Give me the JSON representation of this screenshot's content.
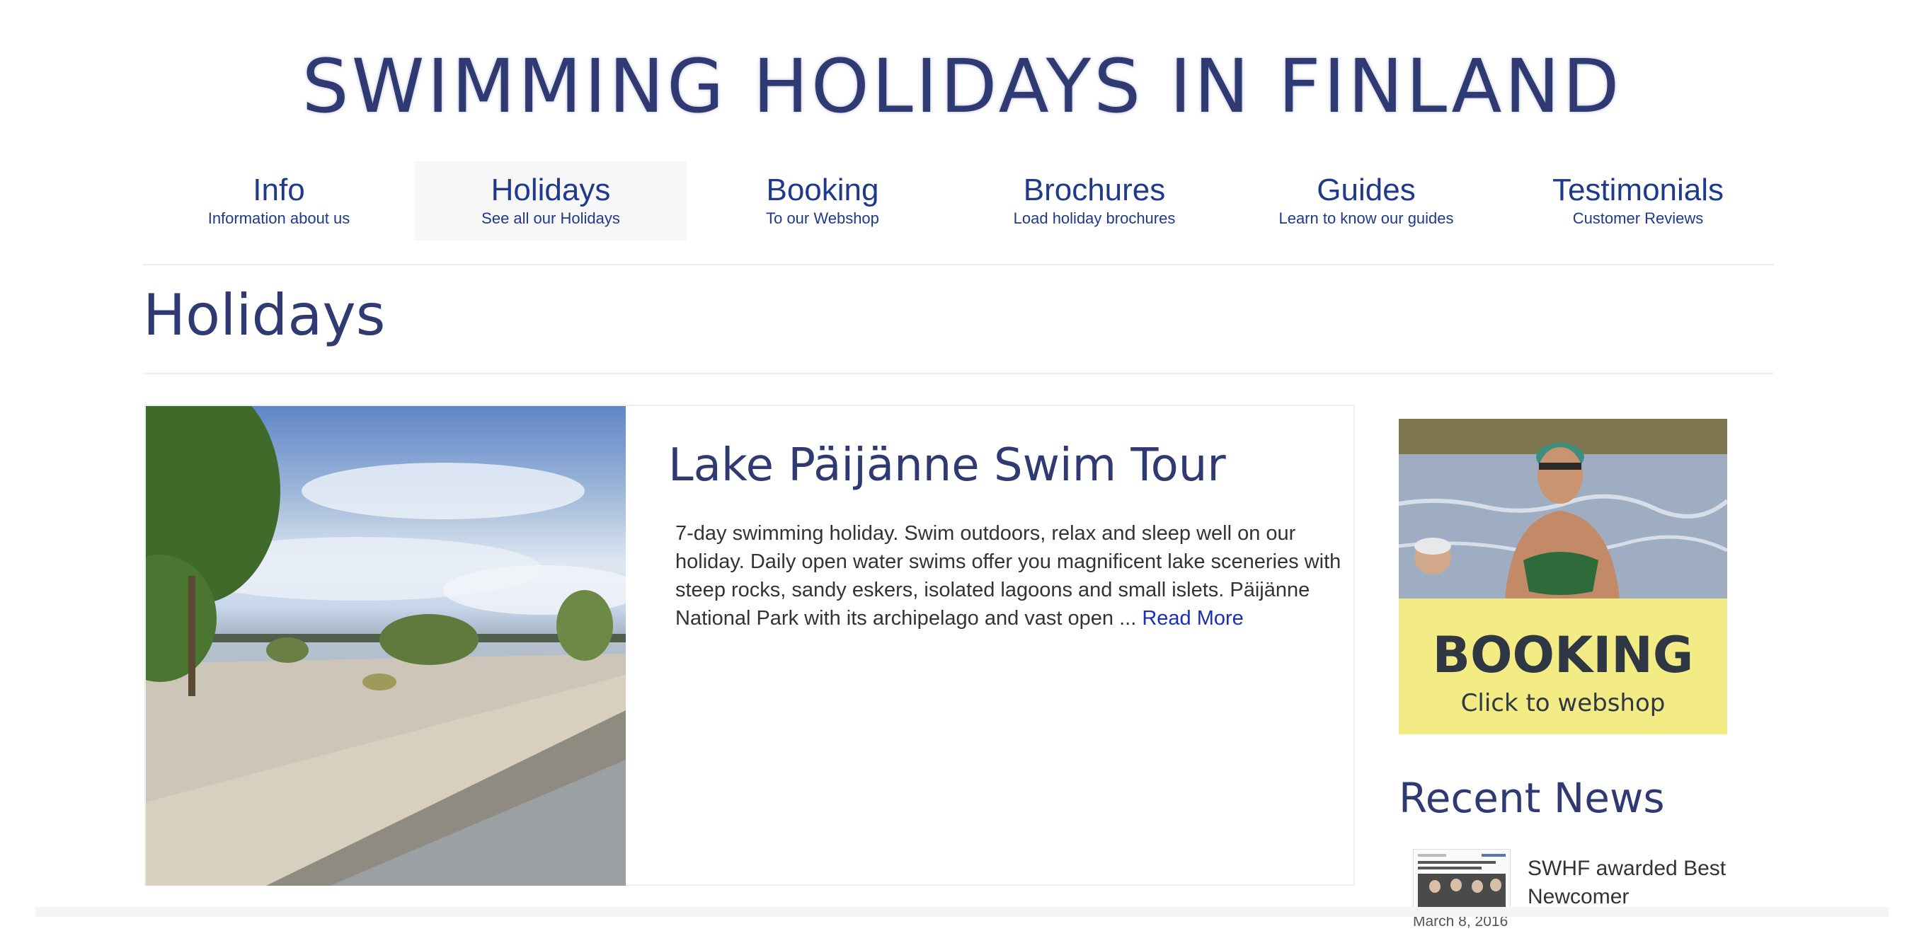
{
  "site": {
    "logo_text": "SWIMMING HOLIDAYS IN FINLAND"
  },
  "nav": {
    "items": [
      {
        "title": "Info",
        "subtitle": "Information about us",
        "active": false
      },
      {
        "title": "Holidays",
        "subtitle": "See all our Holidays",
        "active": true
      },
      {
        "title": "Booking",
        "subtitle": "To our Webshop",
        "active": false
      },
      {
        "title": "Brochures",
        "subtitle": "Load holiday brochures",
        "active": false
      },
      {
        "title": "Guides",
        "subtitle": "Learn to know our guides",
        "active": false
      },
      {
        "title": "Testimonials",
        "subtitle": "Customer Reviews",
        "active": false
      }
    ]
  },
  "page": {
    "title": "Holidays"
  },
  "holiday_card": {
    "title": "Lake Päijänne Swim Tour",
    "excerpt": "7-day swimming holiday. Swim outdoors, relax and sleep well on our holiday. Daily open water swims offer you magnificent lake sceneries with steep rocks, sandy eskers, isolated lagoons and small islets. Päijänne National Park with its archipelago and vast open ...",
    "read_more_label": "Read More"
  },
  "booking_banner": {
    "title": "BOOKING",
    "subtitle": "Click to webshop"
  },
  "recent_news": {
    "heading": "Recent News",
    "items": [
      {
        "title": "SWHF awarded Best Newcomer",
        "date": "March 8, 2016"
      }
    ]
  },
  "colors": {
    "heading": "#2f3a73",
    "nav_link": "#1f3a8a",
    "link": "#1a2fb8",
    "banner_yellow": "#f3ec84"
  }
}
